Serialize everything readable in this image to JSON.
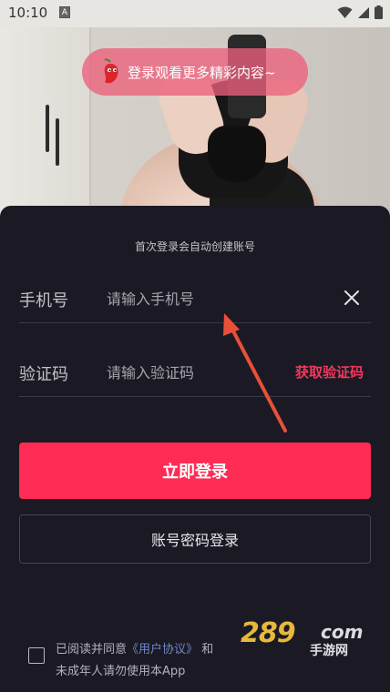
{
  "status_bar": {
    "time": "10:10",
    "indicator": "A",
    "icons": [
      "wifi-icon",
      "signal-icon",
      "battery-icon"
    ]
  },
  "toast": {
    "text": "登录观看更多精彩内容~",
    "icon": "chili-pepper-icon"
  },
  "login": {
    "hint": "首次登录会自动创建账号",
    "phone": {
      "label": "手机号",
      "placeholder": "请输入手机号",
      "value": ""
    },
    "code": {
      "label": "验证码",
      "placeholder": "请输入验证码",
      "value": "",
      "get_code": "获取验证码"
    },
    "login_button": "立即登录",
    "password_login_button": "账号密码登录",
    "agreement": {
      "prefix": "已阅读并同意",
      "user_agreement": "《用户协议》",
      "and": "和",
      "line2": "未成年人请勿使用本App",
      "checked": false
    }
  },
  "watermark": {
    "digits": "289",
    "com": "com",
    "label": "手游网"
  },
  "colors": {
    "accent": "#fe2c55",
    "sheet_bg": "#1b1a24",
    "link": "#6f86c9",
    "annotation_arrow": "#e8503a"
  }
}
